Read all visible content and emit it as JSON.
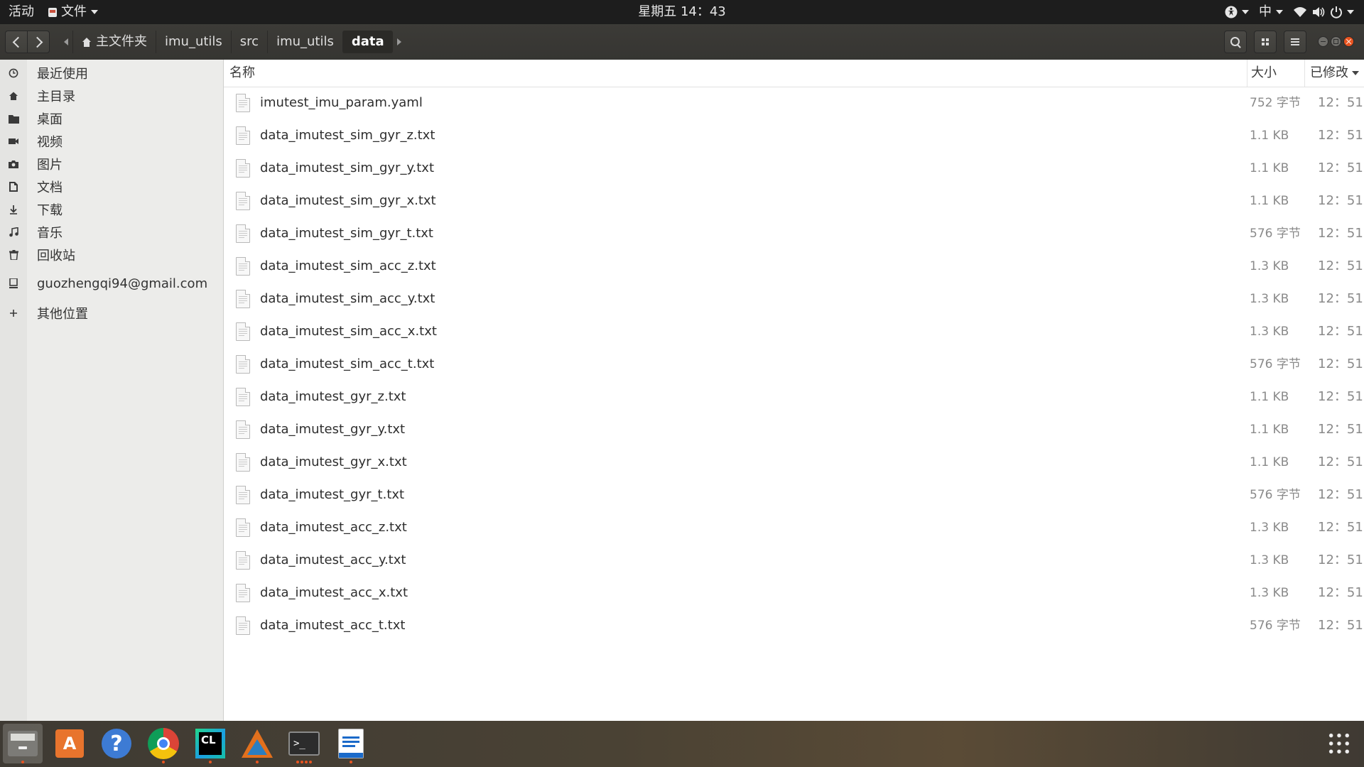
{
  "topbar": {
    "activities": "活动",
    "app_menu": "文件",
    "clock": "星期五 14：43",
    "input_method": "中"
  },
  "pathbar": {
    "crumbs": [
      "主文件夹",
      "imu_utils",
      "src",
      "imu_utils",
      "data"
    ]
  },
  "sidebar": {
    "items": [
      {
        "label": "最近使用",
        "icon": "clock-icon"
      },
      {
        "label": "主目录",
        "icon": "home-icon"
      },
      {
        "label": "桌面",
        "icon": "folder-icon"
      },
      {
        "label": "视频",
        "icon": "video-icon"
      },
      {
        "label": "图片",
        "icon": "camera-icon"
      },
      {
        "label": "文档",
        "icon": "document-icon"
      },
      {
        "label": "下载",
        "icon": "download-icon"
      },
      {
        "label": "音乐",
        "icon": "music-icon"
      },
      {
        "label": "回收站",
        "icon": "trash-icon"
      },
      {
        "label": "guozhengqi94@gmail.com",
        "icon": "network-account-icon"
      },
      {
        "label": "其他位置",
        "icon": "plus-icon"
      }
    ]
  },
  "columns": {
    "name": "名称",
    "size": "大小",
    "modified": "已修改"
  },
  "files": [
    {
      "name": "imutest_imu_param.yaml",
      "size": "752 字节",
      "modified": "12：51"
    },
    {
      "name": "data_imutest_sim_gyr_z.txt",
      "size": "1.1 KB",
      "modified": "12：51"
    },
    {
      "name": "data_imutest_sim_gyr_y.txt",
      "size": "1.1 KB",
      "modified": "12：51"
    },
    {
      "name": "data_imutest_sim_gyr_x.txt",
      "size": "1.1 KB",
      "modified": "12：51"
    },
    {
      "name": "data_imutest_sim_gyr_t.txt",
      "size": "576 字节",
      "modified": "12：51"
    },
    {
      "name": "data_imutest_sim_acc_z.txt",
      "size": "1.3 KB",
      "modified": "12：51"
    },
    {
      "name": "data_imutest_sim_acc_y.txt",
      "size": "1.3 KB",
      "modified": "12：51"
    },
    {
      "name": "data_imutest_sim_acc_x.txt",
      "size": "1.3 KB",
      "modified": "12：51"
    },
    {
      "name": "data_imutest_sim_acc_t.txt",
      "size": "576 字节",
      "modified": "12：51"
    },
    {
      "name": "data_imutest_gyr_z.txt",
      "size": "1.1 KB",
      "modified": "12：51"
    },
    {
      "name": "data_imutest_gyr_y.txt",
      "size": "1.1 KB",
      "modified": "12：51"
    },
    {
      "name": "data_imutest_gyr_x.txt",
      "size": "1.1 KB",
      "modified": "12：51"
    },
    {
      "name": "data_imutest_gyr_t.txt",
      "size": "576 字节",
      "modified": "12：51"
    },
    {
      "name": "data_imutest_acc_z.txt",
      "size": "1.3 KB",
      "modified": "12：51"
    },
    {
      "name": "data_imutest_acc_y.txt",
      "size": "1.3 KB",
      "modified": "12：51"
    },
    {
      "name": "data_imutest_acc_x.txt",
      "size": "1.3 KB",
      "modified": "12：51"
    },
    {
      "name": "data_imutest_acc_t.txt",
      "size": "576 字节",
      "modified": "12：51"
    }
  ],
  "dock": {
    "apps": [
      {
        "name": "files-icon",
        "active": true
      },
      {
        "name": "software-store-icon"
      },
      {
        "name": "help-icon"
      },
      {
        "name": "chrome-icon"
      },
      {
        "name": "clion-icon"
      },
      {
        "name": "matlab-icon"
      },
      {
        "name": "terminal-icon"
      },
      {
        "name": "writer-icon"
      }
    ],
    "store_glyph": "A",
    "help_glyph": "?",
    "terminal_glyph": ">_"
  },
  "colors": {
    "accent": "#e95420",
    "topbar_bg": "#1d1d1d",
    "headerbar_bg": "#3c3b37",
    "sidebar_bg": "#ececea"
  }
}
